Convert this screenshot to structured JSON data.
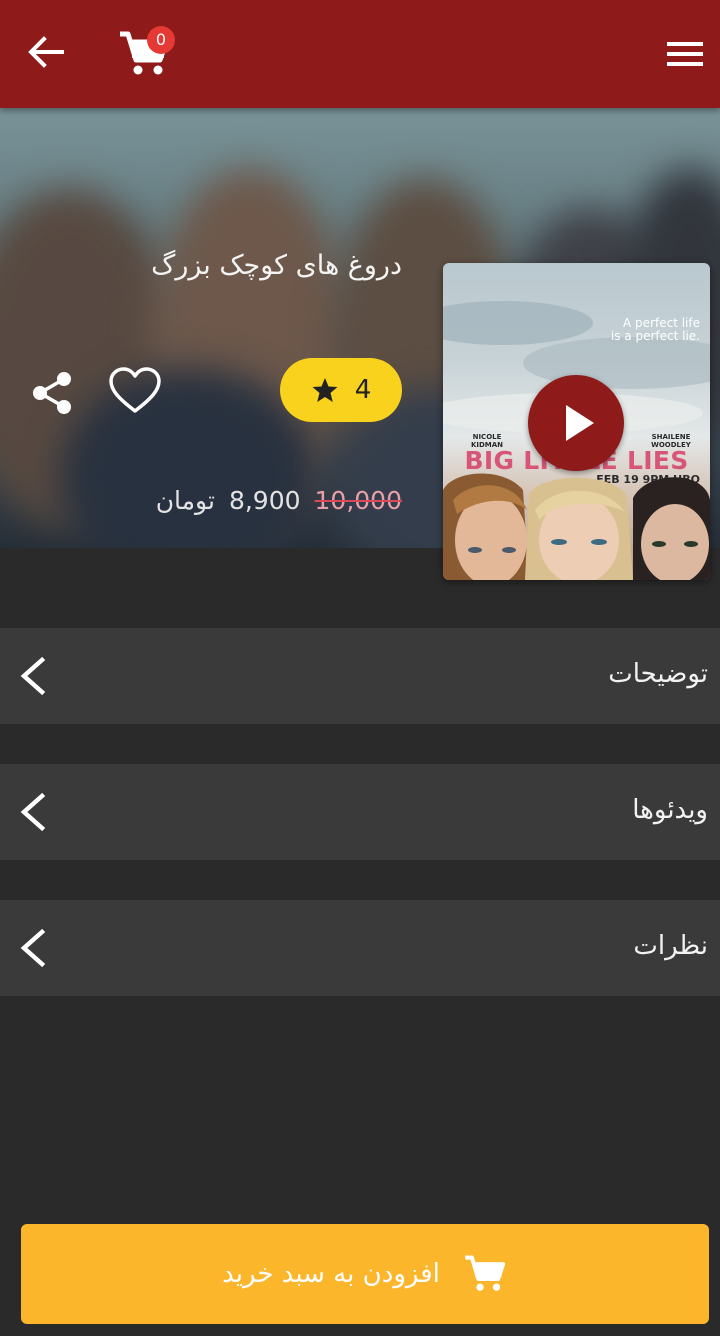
{
  "header": {
    "cart_count": "0",
    "icons": {
      "back": "arrow-left-icon",
      "cart": "shopping-cart-icon",
      "menu": "hamburger-menu-icon"
    },
    "bar_color": "#8e1a1a"
  },
  "product": {
    "title": "دروغ های کوچک بزرگ",
    "rating": "4",
    "old_price": "10,000",
    "new_price": "8,900",
    "currency": "تومان",
    "icons": {
      "share": "share-icon",
      "favorite": "heart-outline-icon",
      "rating": "star-icon",
      "play": "play-icon"
    }
  },
  "poster": {
    "tagline": "A perfect life\nis a perfect lie.",
    "credit_left": "NICOLE\nKIDMAN",
    "credit_right": "SHAILENE\nWOODLEY",
    "title": "BIG LITTLE LIES",
    "date": "FEB 19 9PM HBO"
  },
  "sections": [
    {
      "label": "توضیحات"
    },
    {
      "label": "ویدئوها"
    },
    {
      "label": "نظرات"
    }
  ],
  "cta": {
    "label": "افزودن به سبد خرید",
    "color": "#fbb62c"
  }
}
